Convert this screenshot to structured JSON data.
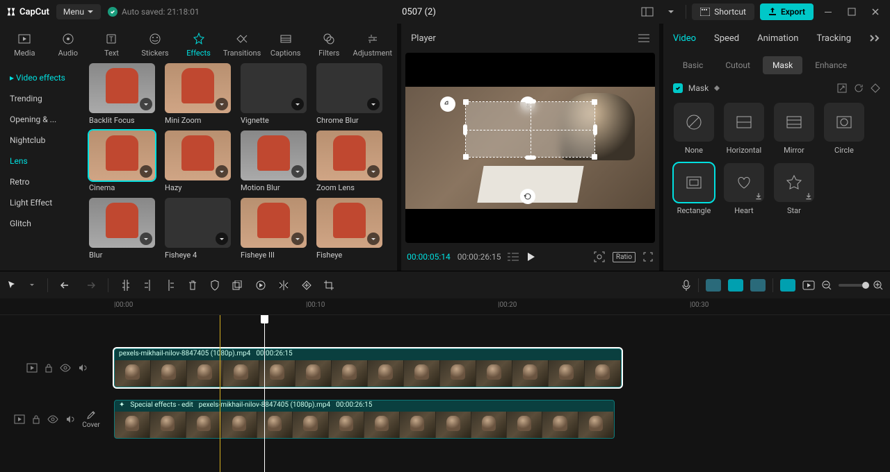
{
  "titlebar": {
    "app_name": "CapCut",
    "menu_label": "Menu",
    "autosave_label": "Auto saved: 21:18:01",
    "project_title": "0507 (2)",
    "shortcut_label": "Shortcut",
    "export_label": "Export"
  },
  "categories": [
    {
      "label": "Media"
    },
    {
      "label": "Audio"
    },
    {
      "label": "Text"
    },
    {
      "label": "Stickers"
    },
    {
      "label": "Effects",
      "active": true
    },
    {
      "label": "Transitions"
    },
    {
      "label": "Captions"
    },
    {
      "label": "Filters"
    },
    {
      "label": "Adjustment"
    }
  ],
  "side_nav": {
    "header": "Video effects",
    "items": [
      {
        "label": "Trending"
      },
      {
        "label": "Opening & ..."
      },
      {
        "label": "Nightclub"
      },
      {
        "label": "Lens",
        "active": true
      },
      {
        "label": "Retro"
      },
      {
        "label": "Light Effect"
      },
      {
        "label": "Glitch"
      }
    ]
  },
  "effects": [
    {
      "label": "Backlit Focus",
      "variant": "gray"
    },
    {
      "label": "Mini Zoom",
      "variant": "person"
    },
    {
      "label": "Vignette",
      "variant": "dark"
    },
    {
      "label": "Chrome Blur",
      "variant": "chrome"
    },
    {
      "label": "Cinema",
      "variant": "person",
      "selected": true
    },
    {
      "label": "Hazy",
      "variant": "person"
    },
    {
      "label": "Motion Blur",
      "variant": "gray"
    },
    {
      "label": "Zoom Lens",
      "variant": "person"
    },
    {
      "label": "Blur",
      "variant": "gray"
    },
    {
      "label": "Fisheye 4",
      "variant": "dark"
    },
    {
      "label": "Fisheye III",
      "variant": "person"
    },
    {
      "label": "Fisheye",
      "variant": "person"
    }
  ],
  "player": {
    "header": "Player",
    "current_time": "00:00:05:14",
    "duration": "00:00:26:15",
    "ratio_label": "Ratio"
  },
  "right": {
    "tabs": [
      {
        "label": "Video",
        "active": true
      },
      {
        "label": "Speed"
      },
      {
        "label": "Animation"
      },
      {
        "label": "Tracking"
      }
    ],
    "subtabs": [
      {
        "label": "Basic"
      },
      {
        "label": "Cutout"
      },
      {
        "label": "Mask",
        "active": true
      },
      {
        "label": "Enhance"
      }
    ],
    "mask_label": "Mask",
    "mask_options": [
      {
        "label": "None",
        "shape": "none"
      },
      {
        "label": "Horizontal",
        "shape": "horizontal"
      },
      {
        "label": "Mirror",
        "shape": "mirror"
      },
      {
        "label": "Circle",
        "shape": "circle"
      },
      {
        "label": "Rectangle",
        "shape": "rect",
        "selected": true
      },
      {
        "label": "Heart",
        "shape": "heart",
        "download": true
      },
      {
        "label": "Star",
        "shape": "star",
        "download": true
      }
    ]
  },
  "ruler": [
    {
      "label": "|00:00",
      "pos": 164
    },
    {
      "label": "|00:10",
      "pos": 440
    },
    {
      "label": "|00:20",
      "pos": 716
    },
    {
      "label": "|00:30",
      "pos": 992
    }
  ],
  "timeline": {
    "cover_label": "Cover",
    "clip1": {
      "name": "pexels-mikhail-nilov-8847405 (1080p).mp4",
      "dur": "00:00:26:15"
    },
    "clip2": {
      "prefix": "Special effects - edit",
      "name": "pexels-mikhail-nilov-8847405 (1080p).mp4",
      "dur": "00:00:26:15"
    }
  }
}
